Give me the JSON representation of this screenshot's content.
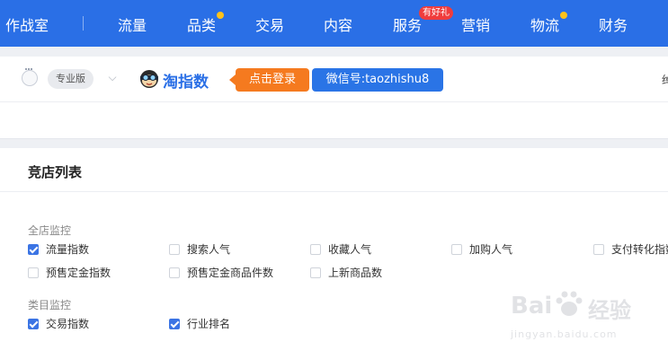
{
  "topnav": {
    "brand": "作战室",
    "items": [
      {
        "label": "流量",
        "dot": false
      },
      {
        "label": "品类",
        "dot": true
      },
      {
        "label": "交易",
        "dot": false
      },
      {
        "label": "内容",
        "dot": false
      },
      {
        "label": "服务",
        "dot": false
      },
      {
        "label": "营销",
        "dot": false
      },
      {
        "label": "物流",
        "dot": true
      },
      {
        "label": "财务",
        "dot": false
      }
    ],
    "gift_badge": "有好礼",
    "accent": "#2a6fe6",
    "dot_color": "#ffc21a"
  },
  "toolbar": {
    "edition": "专业版",
    "plugin_name": "淘指数",
    "login_button": "点击登录",
    "wechat_id": "微信号:taozhishu8",
    "right_cut_text": "绰"
  },
  "card": {
    "title": "竞店列表",
    "groups": [
      {
        "label": "全店监控",
        "options": [
          {
            "label": "流量指数",
            "checked": true
          },
          {
            "label": "搜索人气",
            "checked": false
          },
          {
            "label": "收藏人气",
            "checked": false
          },
          {
            "label": "加购人气",
            "checked": false
          },
          {
            "label": "支付转化指数",
            "checked": false
          },
          {
            "label": "预售定金指数",
            "checked": false
          },
          {
            "label": "预售定金商品件数",
            "checked": false
          },
          {
            "label": "上新商品数",
            "checked": false
          }
        ]
      },
      {
        "label": "类目监控",
        "options": [
          {
            "label": "交易指数",
            "checked": true
          },
          {
            "label": "行业排名",
            "checked": true
          }
        ]
      }
    ]
  },
  "watermark": {
    "line1a": "Bai",
    "line1b": "经验",
    "line2": "jingyan.baidu.com"
  }
}
